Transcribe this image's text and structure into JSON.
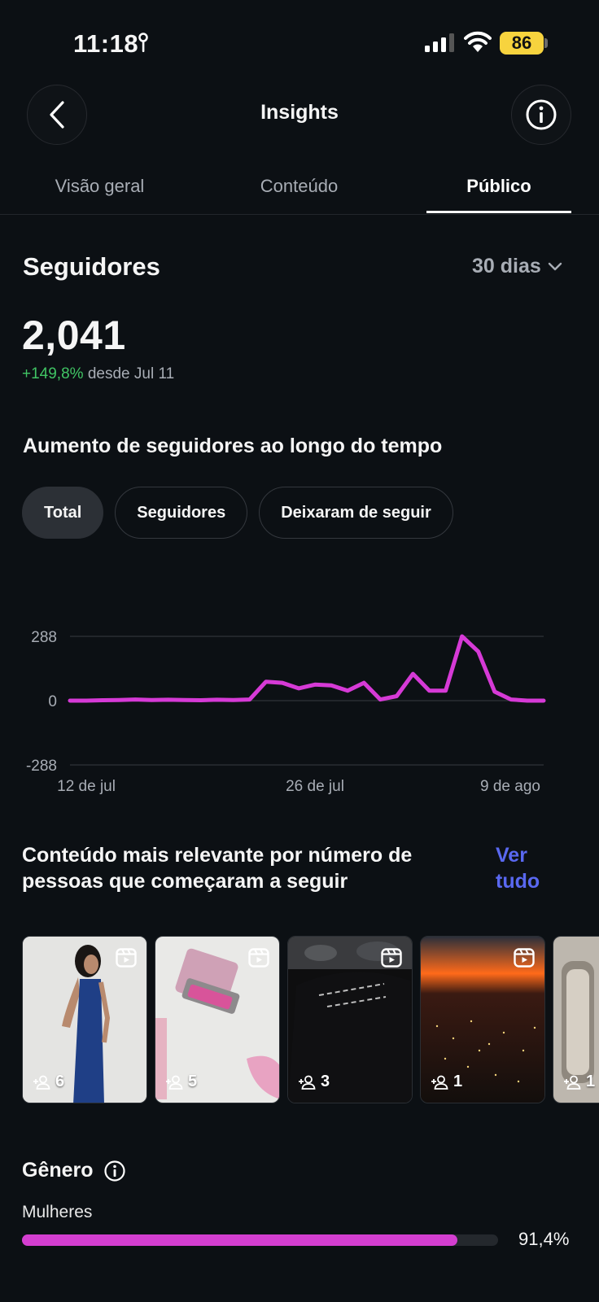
{
  "status_bar": {
    "time": "11:18",
    "battery": "86"
  },
  "header": {
    "title": "Insights"
  },
  "tabs": [
    {
      "label": "Visão geral",
      "active": false
    },
    {
      "label": "Conteúdo",
      "active": false
    },
    {
      "label": "Público",
      "active": true
    }
  ],
  "followers": {
    "title": "Seguidores",
    "period": "30 dias",
    "count": "2,041",
    "delta_pct": "+149,8%",
    "delta_since": "desde Jul 11"
  },
  "growth": {
    "title": "Aumento de seguidores ao longo do tempo",
    "filters": [
      {
        "label": "Total",
        "active": true
      },
      {
        "label": "Seguidores",
        "active": false
      },
      {
        "label": "Deixaram de seguir",
        "active": false
      }
    ]
  },
  "chart_data": {
    "type": "line",
    "x": [
      "11/07",
      "12/07",
      "13/07",
      "14/07",
      "15/07",
      "16/07",
      "17/07",
      "18/07",
      "19/07",
      "20/07",
      "21/07",
      "22/07",
      "23/07",
      "24/07",
      "25/07",
      "26/07",
      "27/07",
      "28/07",
      "29/07",
      "30/07",
      "31/07",
      "01/08",
      "02/08",
      "03/08",
      "04/08",
      "05/08",
      "06/08",
      "07/08",
      "08/08",
      "09/08"
    ],
    "series": [
      {
        "values": [
          0,
          0,
          2,
          3,
          5,
          3,
          4,
          3,
          2,
          4,
          3,
          5,
          85,
          80,
          55,
          72,
          68,
          45,
          80,
          5,
          20,
          120,
          45,
          45,
          288,
          220,
          40,
          5,
          0,
          0
        ],
        "color": "#d63ad6"
      }
    ],
    "y_ticks": [
      "288",
      "0",
      "-288"
    ],
    "x_ticks": [
      "12 de jul",
      "26 de jul",
      "9 de ago"
    ],
    "ylim": [
      -288,
      288
    ],
    "grid": true
  },
  "top_content": {
    "title": "Conteúdo mais relevante por número de pessoas que começaram a seguir",
    "see_all": "Ver tudo",
    "items": [
      {
        "count": "6",
        "icon": "reel-icon"
      },
      {
        "count": "5",
        "icon": "reel-icon"
      },
      {
        "count": "3",
        "icon": "reel-icon"
      },
      {
        "count": "1",
        "icon": "reel-icon"
      },
      {
        "count": "1",
        "icon": "reel-icon"
      }
    ]
  },
  "gender": {
    "title": "Gênero",
    "label": "Mulheres",
    "value_text": "91,4%",
    "value": 0.914
  }
}
